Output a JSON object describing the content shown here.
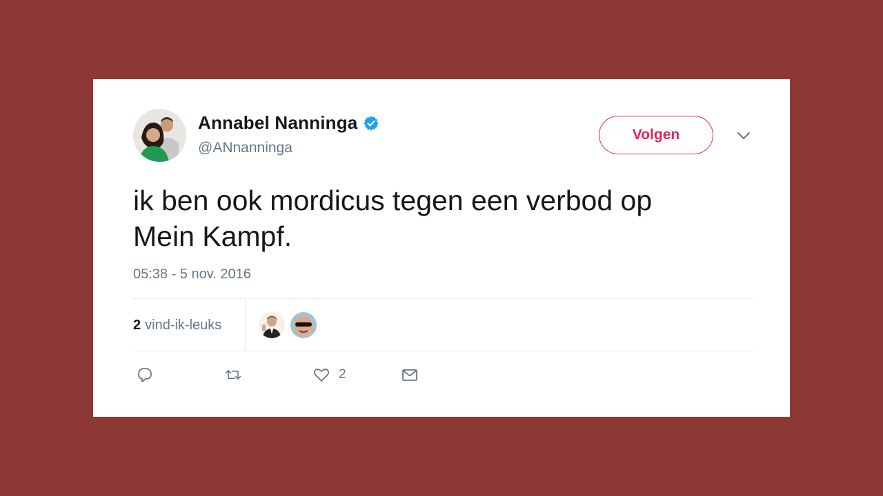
{
  "author": {
    "display_name": "Annabel Nanninga",
    "handle": "@ANnanninga",
    "verified": true
  },
  "follow_button_label": "Volgen",
  "tweet": {
    "text_line1": "ik ben ook mordicus tegen een verbod op",
    "text_line2": "Mein Kampf.",
    "timestamp": "05:38 - 5 nov. 2016"
  },
  "likes": {
    "count": "2",
    "label": "vind-ik-leuks"
  },
  "actions": {
    "reply_icon": "reply-icon",
    "retweet_icon": "retweet-icon",
    "like_icon": "heart-icon",
    "like_count": "2",
    "message_icon": "envelope-icon"
  },
  "colors": {
    "background": "#8e3835",
    "follow_accent": "#e0245e",
    "verified_blue": "#1da1f2",
    "secondary_text": "#657786"
  }
}
